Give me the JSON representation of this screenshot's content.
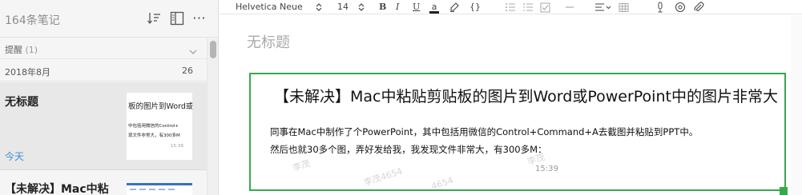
{
  "sidebar": {
    "note_count": "164条笔记",
    "reminder": {
      "label": "提醒",
      "count": "(1)"
    },
    "month": {
      "label": "2018年8月",
      "count": "26"
    },
    "notes": [
      {
        "title": "无标题",
        "date": "今天",
        "thumb_line1": "板的图片到Word或",
        "thumb_line2": "中包括用微信的Control+",
        "thumb_line3": "现文件非常大，有300多M",
        "thumb_time": "15:39"
      },
      {
        "title": "【未解决】Mac中粘"
      }
    ],
    "icons": [
      "sort-icon",
      "layout-icon",
      "more-icon",
      "chevron-down-icon"
    ]
  },
  "toolbar": {
    "font_name": "Helvetica Neue",
    "font_size": "14",
    "bold": "B",
    "italic": "I",
    "underline": "U",
    "font_color": "a",
    "code": "{}"
  },
  "editor": {
    "title_placeholder": "无标题",
    "embed": {
      "title": "【未解决】Mac中粘贴剪贴板的图片到Word或PowerPoint中的图片非常大",
      "line1": "同事在Mac中制作了个PowerPoint，其中包括用微信的Control+Command+A去截图并粘贴到PPT中。",
      "line2": "然后也就30多个图，弄好发给我，我发现文件非常大，有300多M：",
      "time": "15:39",
      "watermarks": [
        "李茂",
        "李茂4654",
        "李茂",
        "4654"
      ]
    }
  },
  "colors": {
    "accent_green": "#39a84d",
    "date_blue": "#3c8ed4",
    "sidebar_bg": "#f5f5f5",
    "selected_bg": "#e8e8e8"
  }
}
